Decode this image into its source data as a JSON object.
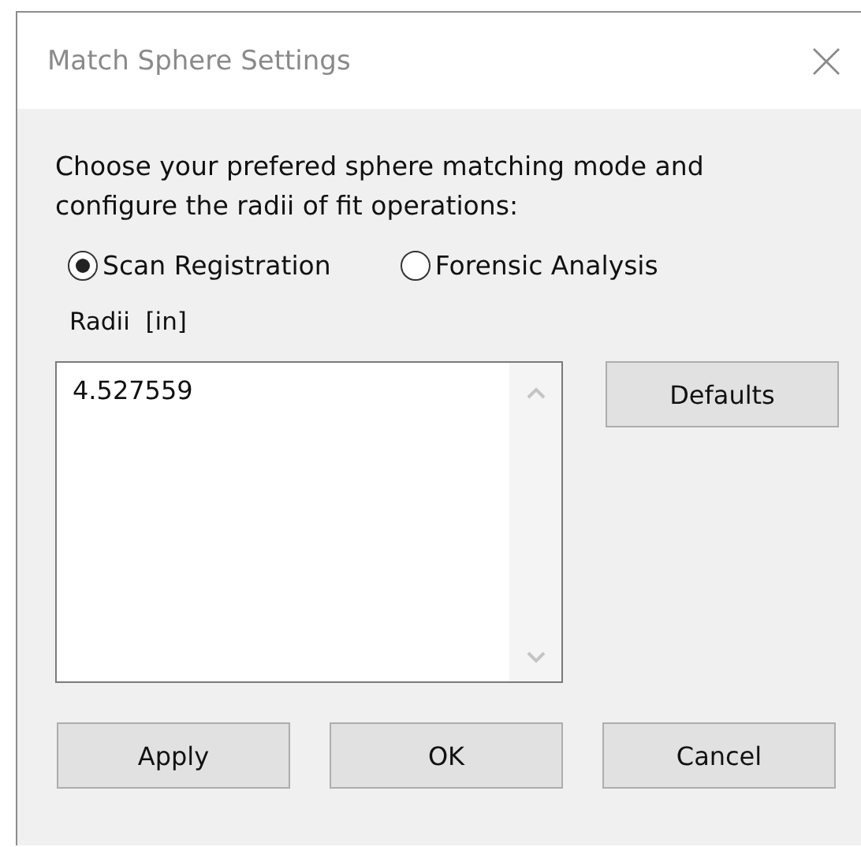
{
  "window": {
    "title": "Match Sphere Settings"
  },
  "description": "Choose your prefered sphere matching mode and configure the radii of fit operations:",
  "modes": [
    {
      "label": "Scan Registration",
      "selected": true
    },
    {
      "label": "Forensic Analysis",
      "selected": false
    }
  ],
  "radii": {
    "label": "Radii  [in]",
    "values": [
      "4.527559"
    ]
  },
  "side_buttons": [
    "Defaults"
  ],
  "buttons": [
    "Apply",
    "OK",
    "Cancel"
  ]
}
